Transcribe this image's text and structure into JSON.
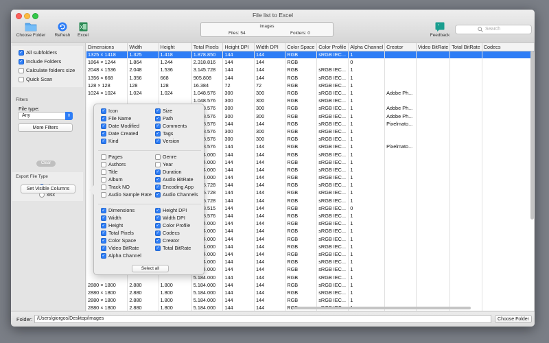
{
  "window": {
    "title": "File list to Excel"
  },
  "toolbar": {
    "choose_folder": "Choose Folder",
    "refresh": "Refresh",
    "excel": "Excel",
    "feedback": "Feedback",
    "search_placeholder": "Search"
  },
  "status": {
    "title": "images",
    "files": "Files: 54",
    "folders": "Folders: 0"
  },
  "options": {
    "all_subfolders": "All subfolders",
    "include_folders": "Include Folders",
    "calc_size": "Calculate folders size",
    "quick_scan": "Quick Scan"
  },
  "filters": {
    "header": "Filters",
    "file_type_label": "File type:",
    "file_type_value": "Any",
    "more_filters": "More Filters",
    "clear": "Clear"
  },
  "export": {
    "header": "Export File Type",
    "xls": "xls",
    "xlsx": "xlsx"
  },
  "set_columns": "Set Visible Columns",
  "popover": {
    "group1": [
      {
        "label": "Icon",
        "checked": true
      },
      {
        "label": "Size",
        "checked": true
      },
      {
        "label": "File Name",
        "checked": true
      },
      {
        "label": "Path",
        "checked": true
      },
      {
        "label": "Date Modified",
        "checked": true
      },
      {
        "label": "Comments",
        "checked": true
      },
      {
        "label": "Date Created",
        "checked": true
      },
      {
        "label": "Tags",
        "checked": true
      },
      {
        "label": "Kind",
        "checked": true
      },
      {
        "label": "Version",
        "checked": true
      }
    ],
    "group2": [
      {
        "label": "Pages",
        "checked": false
      },
      {
        "label": "Genre",
        "checked": false
      },
      {
        "label": "Authors",
        "checked": false
      },
      {
        "label": "Year",
        "checked": false
      },
      {
        "label": "Title",
        "checked": false
      },
      {
        "label": "Duration",
        "checked": true
      },
      {
        "label": "Album",
        "checked": false
      },
      {
        "label": "Audio BitRate",
        "checked": true
      },
      {
        "label": "Track NO",
        "checked": false
      },
      {
        "label": "Encoding App",
        "checked": true
      },
      {
        "label": "Audio Sample Rate",
        "checked": false
      },
      {
        "label": "Audio Channels",
        "checked": true
      }
    ],
    "group3": [
      {
        "label": "Dimensions",
        "checked": true
      },
      {
        "label": "Height DPI",
        "checked": true
      },
      {
        "label": "Width",
        "checked": true
      },
      {
        "label": "Width DPI",
        "checked": true
      },
      {
        "label": "Height",
        "checked": true
      },
      {
        "label": "Color Profile",
        "checked": true
      },
      {
        "label": "Total Pixels",
        "checked": true
      },
      {
        "label": "Codecs",
        "checked": true
      },
      {
        "label": "Color Space",
        "checked": true
      },
      {
        "label": "Creator",
        "checked": true
      },
      {
        "label": "Video BitRate",
        "checked": true
      },
      {
        "label": "Total BitRate",
        "checked": true
      },
      {
        "label": "Alpha Channel",
        "checked": true
      }
    ],
    "select_all": "Select all"
  },
  "table": {
    "columns": [
      "Dimensions",
      "Width",
      "Height",
      "Total Pixels",
      "Height DPI",
      "Width DPI",
      "Color Space",
      "Color Profile",
      "Alpha Channel",
      "Creator",
      "Video BitRate",
      "Total BitRate",
      "Codecs"
    ],
    "rows": [
      [
        "1325 × 1418",
        "1.325",
        "1.418",
        "1.878.850",
        "144",
        "144",
        "RGB",
        "sRGB IEC...",
        "1",
        "",
        "",
        "",
        ""
      ],
      [
        "1864 × 1244",
        "1.864",
        "1.244",
        "2.318.816",
        "144",
        "144",
        "RGB",
        "",
        "0",
        "",
        "",
        "",
        ""
      ],
      [
        "2048 × 1536",
        "2.048",
        "1.536",
        "3.145.728",
        "144",
        "144",
        "RGB",
        "sRGB IEC...",
        "1",
        "",
        "",
        "",
        ""
      ],
      [
        "1356 × 668",
        "1.356",
        "668",
        "905.808",
        "144",
        "144",
        "RGB",
        "sRGB IEC...",
        "1",
        "",
        "",
        "",
        ""
      ],
      [
        "128 × 128",
        "128",
        "128",
        "16.384",
        "72",
        "72",
        "RGB",
        "sRGB IEC...",
        "1",
        "",
        "",
        "",
        ""
      ],
      [
        "1024 × 1024",
        "1.024",
        "1.024",
        "1.048.576",
        "300",
        "300",
        "RGB",
        "sRGB IEC...",
        "1",
        "Adobe Ph...",
        "",
        "",
        ""
      ],
      [
        "",
        "",
        "",
        "1.048.576",
        "300",
        "300",
        "RGB",
        "sRGB IEC...",
        "1",
        "",
        "",
        "",
        ""
      ],
      [
        "",
        "",
        "",
        "1.048.576",
        "300",
        "300",
        "RGB",
        "sRGB IEC...",
        "1",
        "Adobe Ph...",
        "",
        "",
        ""
      ],
      [
        "",
        "",
        "",
        "1.048.576",
        "300",
        "300",
        "RGB",
        "sRGB IEC...",
        "1",
        "Adobe Ph...",
        "",
        "",
        ""
      ],
      [
        "",
        "",
        "",
        "1.048.576",
        "144",
        "144",
        "RGB",
        "sRGB IEC...",
        "1",
        "Pixelmato...",
        "",
        "",
        ""
      ],
      [
        "",
        "",
        "",
        "1.048.576",
        "300",
        "300",
        "RGB",
        "sRGB IEC...",
        "1",
        "",
        "",
        "",
        ""
      ],
      [
        "",
        "",
        "",
        "1.048.576",
        "300",
        "300",
        "RGB",
        "sRGB IEC...",
        "1",
        "",
        "",
        "",
        ""
      ],
      [
        "",
        "",
        "",
        "1.048.576",
        "144",
        "144",
        "RGB",
        "sRGB IEC...",
        "1",
        "Pixelmato...",
        "",
        "",
        ""
      ],
      [
        "",
        "",
        "",
        "5.184.000",
        "144",
        "144",
        "RGB",
        "sRGB IEC...",
        "1",
        "",
        "",
        "",
        ""
      ],
      [
        "",
        "",
        "",
        "5.184.000",
        "144",
        "144",
        "RGB",
        "sRGB IEC...",
        "1",
        "",
        "",
        "",
        ""
      ],
      [
        "",
        "",
        "",
        "5.184.000",
        "144",
        "144",
        "RGB",
        "sRGB IEC...",
        "1",
        "",
        "",
        "",
        ""
      ],
      [
        "",
        "",
        "",
        "5.184.000",
        "144",
        "144",
        "RGB",
        "sRGB IEC...",
        "1",
        "",
        "",
        "",
        ""
      ],
      [
        "",
        "",
        "",
        "3.145.728",
        "144",
        "144",
        "RGB",
        "sRGB IEC...",
        "1",
        "",
        "",
        "",
        ""
      ],
      [
        "",
        "",
        "",
        "3.145.728",
        "144",
        "144",
        "RGB",
        "sRGB IEC...",
        "1",
        "",
        "",
        "",
        ""
      ],
      [
        "",
        "",
        "",
        "3.145.728",
        "144",
        "144",
        "RGB",
        "sRGB IEC...",
        "1",
        "",
        "",
        "",
        ""
      ],
      [
        "",
        "",
        "",
        "1.048.515",
        "144",
        "144",
        "RGB",
        "sRGB IEC...",
        "0",
        "",
        "",
        "",
        ""
      ],
      [
        "",
        "",
        "",
        "1.048.576",
        "144",
        "144",
        "RGB",
        "sRGB IEC...",
        "1",
        "",
        "",
        "",
        ""
      ],
      [
        "",
        "",
        "",
        "5.184.000",
        "144",
        "144",
        "RGB",
        "sRGB IEC...",
        "1",
        "",
        "",
        "",
        ""
      ],
      [
        "",
        "",
        "",
        "5.184.000",
        "144",
        "144",
        "RGB",
        "sRGB IEC...",
        "1",
        "",
        "",
        "",
        ""
      ],
      [
        "",
        "",
        "",
        "5.184.000",
        "144",
        "144",
        "RGB",
        "sRGB IEC...",
        "1",
        "",
        "",
        "",
        ""
      ],
      [
        "",
        "",
        "",
        "5.184.000",
        "144",
        "144",
        "RGB",
        "sRGB IEC...",
        "1",
        "",
        "",
        "",
        ""
      ],
      [
        "",
        "",
        "",
        "5.184.000",
        "144",
        "144",
        "RGB",
        "sRGB IEC...",
        "1",
        "",
        "",
        "",
        ""
      ],
      [
        "",
        "",
        "",
        "5.184.000",
        "144",
        "144",
        "RGB",
        "sRGB IEC...",
        "1",
        "",
        "",
        "",
        ""
      ],
      [
        "",
        "",
        "",
        "5.184.000",
        "144",
        "144",
        "RGB",
        "sRGB IEC...",
        "1",
        "",
        "",
        "",
        ""
      ],
      [
        "",
        "",
        "",
        "5.184.000",
        "144",
        "144",
        "RGB",
        "sRGB IEC...",
        "1",
        "",
        "",
        "",
        ""
      ],
      [
        "2880 × 1800",
        "2.880",
        "1.800",
        "5.184.000",
        "144",
        "144",
        "RGB",
        "sRGB IEC...",
        "1",
        "",
        "",
        "",
        ""
      ],
      [
        "2880 × 1800",
        "2.880",
        "1.800",
        "5.184.000",
        "144",
        "144",
        "RGB",
        "sRGB IEC...",
        "1",
        "",
        "",
        "",
        ""
      ],
      [
        "2880 × 1800",
        "2.880",
        "1.800",
        "5.184.000",
        "144",
        "144",
        "RGB",
        "sRGB IEC...",
        "1",
        "",
        "",
        "",
        ""
      ],
      [
        "2880 × 1800",
        "2.880",
        "1.800",
        "5.184.000",
        "144",
        "144",
        "RGB",
        "sRGB IEC...",
        "1",
        "",
        "",
        "",
        ""
      ],
      [
        "2880 × 1800",
        "2.880",
        "1.800",
        "5.184.000",
        "144",
        "144",
        "RGB",
        "sRGB IEC...",
        "1",
        "",
        "",
        "",
        ""
      ]
    ]
  },
  "bottom": {
    "folder_label": "Folder:",
    "path": "/Users/giorgos/Desktop/images",
    "choose_folder": "Choose Folder"
  },
  "colors": {
    "accent": "#2d7df6",
    "excel_green": "#2e8b57",
    "feedback_teal": "#1a9e8f"
  }
}
